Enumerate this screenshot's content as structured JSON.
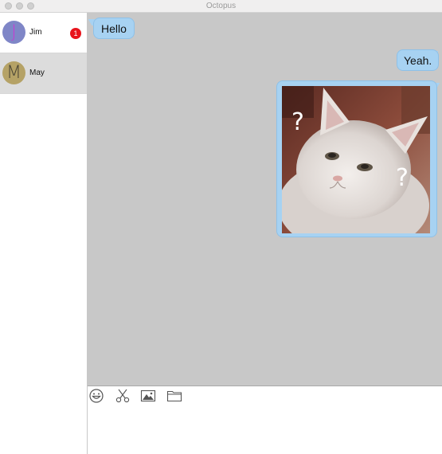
{
  "window": {
    "title": "Octopus"
  },
  "contacts": [
    {
      "initial": "J",
      "name": "Jim",
      "unread": "1"
    },
    {
      "initial": "M",
      "name": "May"
    }
  ],
  "messages": [
    {
      "direction": "incoming",
      "type": "text",
      "text": "Hello"
    },
    {
      "direction": "outgoing",
      "type": "text",
      "text": "Yeah."
    },
    {
      "direction": "outgoing",
      "type": "image",
      "image": "confused-white-cat-photo",
      "overlay_marks": [
        "?",
        "?"
      ]
    }
  ],
  "composer": {
    "tools": [
      "emoji-icon",
      "scissors-icon",
      "image-icon",
      "folder-icon"
    ],
    "input_value": ""
  },
  "colors": {
    "bubble": "#a7d2f2",
    "chat_background": "#c8c8c8",
    "badge": "#e8141c",
    "selected_contact": "#dcdcdc"
  }
}
